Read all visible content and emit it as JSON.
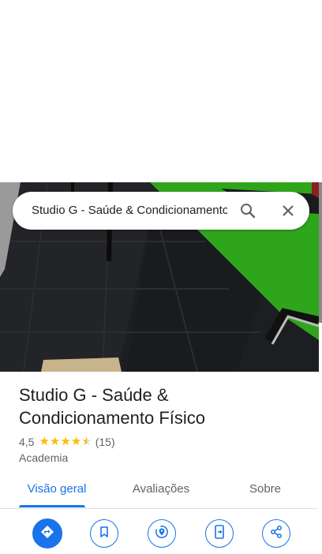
{
  "search": {
    "query": "Studio G - Saúde & Condicionamento Físico",
    "search_icon": "search-icon",
    "close_icon": "close-icon"
  },
  "place": {
    "title": "Studio G - Saúde & Condicionamento Físico",
    "rating": "4,5",
    "rating_value": 4.5,
    "review_count": "(15)",
    "category": "Academia"
  },
  "tabs": [
    {
      "label": "Visão geral",
      "active": true
    },
    {
      "label": "Avaliações",
      "active": false
    },
    {
      "label": "Sobre",
      "active": false
    }
  ],
  "actions": [
    {
      "icon": "directions-icon"
    },
    {
      "icon": "save-icon"
    },
    {
      "icon": "nearby-icon"
    },
    {
      "icon": "send-to-phone-icon"
    },
    {
      "icon": "share-icon"
    }
  ],
  "colors": {
    "accent": "#1a73e8",
    "star": "#fbbc04",
    "turf": "#2fa51c"
  }
}
